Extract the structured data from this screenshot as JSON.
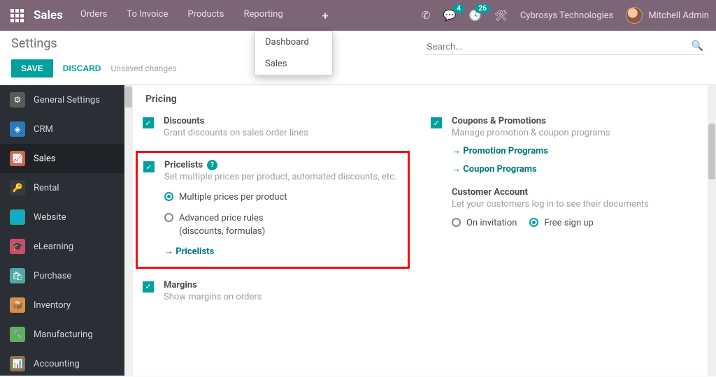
{
  "topbar": {
    "brand": "Sales",
    "nav": [
      "Orders",
      "To Invoice",
      "Products",
      "Reporting"
    ],
    "chat_badge": "4",
    "activity_badge": "26",
    "company": "Cybrosys Technologies",
    "user": "Mitchell Admin"
  },
  "dropdown": {
    "items": [
      "Dashboard",
      "Sales"
    ]
  },
  "control": {
    "title": "Settings",
    "save": "SAVE",
    "discard": "DISCARD",
    "unsaved": "Unsaved changes",
    "search_placeholder": "Search..."
  },
  "sidebar": [
    {
      "label": "General Settings",
      "icon": "gear"
    },
    {
      "label": "CRM",
      "icon": "crm"
    },
    {
      "label": "Sales",
      "icon": "sales",
      "active": true
    },
    {
      "label": "Rental",
      "icon": "rental"
    },
    {
      "label": "Website",
      "icon": "web"
    },
    {
      "label": "eLearning",
      "icon": "learn"
    },
    {
      "label": "Purchase",
      "icon": "purch"
    },
    {
      "label": "Inventory",
      "icon": "inv"
    },
    {
      "label": "Manufacturing",
      "icon": "mfg"
    },
    {
      "label": "Accounting",
      "icon": "acc"
    }
  ],
  "content": {
    "section_title": "Pricing",
    "discounts": {
      "label": "Discounts",
      "desc": "Grant discounts on sales order lines"
    },
    "pricelists": {
      "label": "Pricelists",
      "desc": "Set multiple prices per product, automated discounts, etc.",
      "opt1": "Multiple prices per product",
      "opt2": "Advanced price rules (discounts, formulas)",
      "link": "Pricelists"
    },
    "margins": {
      "label": "Margins",
      "desc": "Show margins on orders"
    },
    "coupons": {
      "label": "Coupons & Promotions",
      "desc": "Manage promotion & coupon programs",
      "link1": "Promotion Programs",
      "link2": "Coupon Programs"
    },
    "customer_acct": {
      "label": "Customer Account",
      "desc": "Let your customers log in to see their documents",
      "opt1": "On invitation",
      "opt2": "Free sign up"
    }
  }
}
